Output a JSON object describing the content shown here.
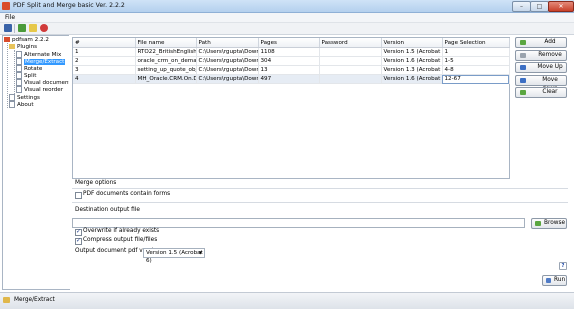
{
  "window": {
    "title": "PDF Split and Merge basic Ver. 2.2.2"
  },
  "menu": {
    "file": "File"
  },
  "toolbar": {
    "icons": [
      "save-icon",
      "open-icon",
      "env-icon",
      "stop-icon"
    ]
  },
  "tree": {
    "root": "pdfsam 2.2.2",
    "plugins": "Plugins",
    "plugin_items": [
      "Alternate Mix",
      "Merge/Extract",
      "Rotate",
      "Split",
      "Visual document ...",
      "Visual reorder"
    ],
    "selected": "Merge/Extract",
    "settings": "Settings",
    "about": "About"
  },
  "table": {
    "headers": [
      "#",
      "File name",
      "Path",
      "Pages",
      "Password",
      "Version",
      "Page Selection"
    ],
    "rows": [
      [
        "1",
        "RTO22_BritishEnglish1.pdf",
        "C:\\Users\\rgupta\\Downlo...",
        "1108",
        "",
        "Version 1.5 (Acrobat 6)",
        "1"
      ],
      [
        "2",
        "oracle_crm_on_demand_...",
        "C:\\Users\\rgupta\\Downlo...",
        "304",
        "",
        "Version 1.6 (Acrobat 7)",
        "1-5"
      ],
      [
        "3",
        "setting_up_quote_object_...",
        "C:\\Users\\rgupta\\Downlo...",
        "13",
        "",
        "Version 1.3 (Acrobat 4)",
        "4-8"
      ],
      [
        "4",
        "MH_Oracle.CRM.On.De...",
        "C:\\Users\\rgupta\\Downlo...",
        "497",
        "",
        "Version 1.6 (Acrobat 7)",
        "12-67"
      ]
    ],
    "selected_row": 4
  },
  "side_buttons": {
    "add": "Add",
    "remove": "Remove",
    "move_up": "Move Up",
    "move_down": "Move down",
    "clear": "Clear"
  },
  "merge_options": {
    "title": "Merge options",
    "pdf_forms_label": "PDF documents contain forms",
    "pdf_forms_checked": false
  },
  "destination": {
    "title": "Destination output file",
    "value": "",
    "browse": "Browse",
    "overwrite_label": "Overwrite if already exists",
    "overwrite_checked": true,
    "compress_label": "Compress output file/files",
    "compress_checked": true,
    "version_label": "Output document pdf version:",
    "version_value": "Version 1.5 (Acrobat 6)"
  },
  "help": "?",
  "run": "Run",
  "status": {
    "text": "Merge/Extract"
  },
  "colors": {
    "selection": "#3399ff",
    "title_bar": "#b4d0ee",
    "close_button": "#c8412b"
  }
}
